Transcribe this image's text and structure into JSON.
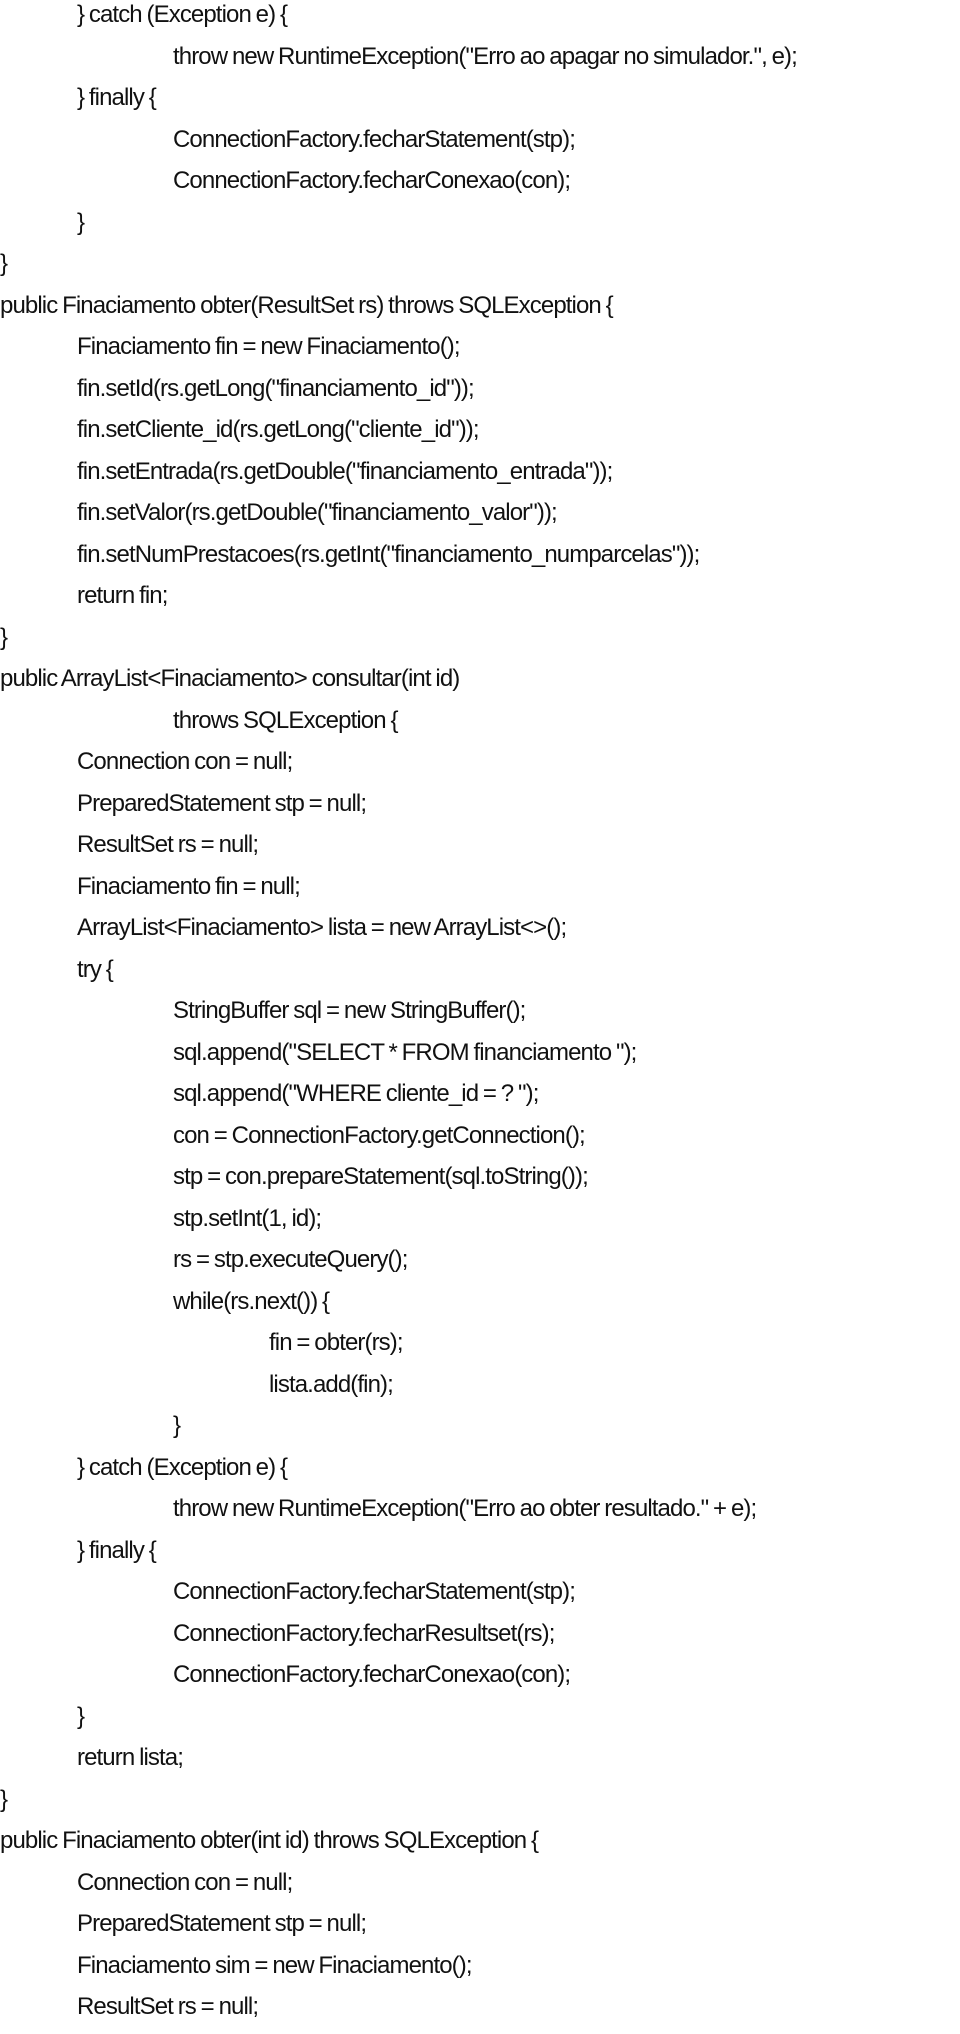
{
  "document": {
    "language": "Java",
    "lines": [
      {
        "indent": 1,
        "text": "} catch (Exception e) {"
      },
      {
        "indent": 2,
        "text": "throw new RuntimeException(\"Erro ao apagar no simulador.\", e);"
      },
      {
        "indent": 1,
        "text": "} finally {"
      },
      {
        "indent": 2,
        "text": "ConnectionFactory.fecharStatement(stp);"
      },
      {
        "indent": 2,
        "text": "ConnectionFactory.fecharConexao(con);"
      },
      {
        "indent": 1,
        "text": "}"
      },
      {
        "indent": 0,
        "text": "}"
      },
      {
        "indent": 0,
        "text": "public Finaciamento obter(ResultSet rs) throws SQLException {"
      },
      {
        "indent": 1,
        "text": "Finaciamento fin = new Finaciamento();"
      },
      {
        "indent": 1,
        "text": "fin.setId(rs.getLong(\"financiamento_id\"));"
      },
      {
        "indent": 1,
        "text": "fin.setCliente_id(rs.getLong(\"cliente_id\"));"
      },
      {
        "indent": 1,
        "text": "fin.setEntrada(rs.getDouble(\"financiamento_entrada\"));"
      },
      {
        "indent": 1,
        "text": "fin.setValor(rs.getDouble(\"financiamento_valor\"));"
      },
      {
        "indent": 1,
        "text": "fin.setNumPrestacoes(rs.getInt(\"financiamento_numparcelas\"));"
      },
      {
        "indent": 1,
        "text": "return fin;"
      },
      {
        "indent": 0,
        "text": "}"
      },
      {
        "indent": 0,
        "text": "public ArrayList<Finaciamento> consultar(int id)"
      },
      {
        "indent": 2,
        "text": "throws SQLException {"
      },
      {
        "indent": 1,
        "text": "Connection con = null;"
      },
      {
        "indent": 1,
        "text": "PreparedStatement stp = null;"
      },
      {
        "indent": 1,
        "text": "ResultSet rs = null;"
      },
      {
        "indent": 1,
        "text": "Finaciamento fin = null;"
      },
      {
        "indent": 1,
        "text": "ArrayList<Finaciamento> lista = new ArrayList<>();"
      },
      {
        "indent": 1,
        "text": "try {"
      },
      {
        "indent": 2,
        "text": "StringBuffer sql = new StringBuffer();"
      },
      {
        "indent": 2,
        "text": "sql.append(\"SELECT * FROM financiamento \");"
      },
      {
        "indent": 2,
        "text": "sql.append(\"WHERE cliente_id = ? \");"
      },
      {
        "indent": 2,
        "text": "con = ConnectionFactory.getConnection();"
      },
      {
        "indent": 2,
        "text": "stp = con.prepareStatement(sql.toString());"
      },
      {
        "indent": 2,
        "text": "stp.setInt(1, id);"
      },
      {
        "indent": 2,
        "text": "rs = stp.executeQuery();"
      },
      {
        "indent": 2,
        "text": "while(rs.next()) {"
      },
      {
        "indent": 3,
        "text": "fin = obter(rs);"
      },
      {
        "indent": 3,
        "text": "lista.add(fin);"
      },
      {
        "indent": 2,
        "text": "}"
      },
      {
        "indent": 1,
        "text": "} catch (Exception e) {"
      },
      {
        "indent": 2,
        "text": "throw new RuntimeException(\"Erro ao obter resultado.\" + e);"
      },
      {
        "indent": 1,
        "text": "} finally {"
      },
      {
        "indent": 2,
        "text": "ConnectionFactory.fecharStatement(stp);"
      },
      {
        "indent": 2,
        "text": "ConnectionFactory.fecharResultset(rs);"
      },
      {
        "indent": 2,
        "text": "ConnectionFactory.fecharConexao(con);"
      },
      {
        "indent": 1,
        "text": "}"
      },
      {
        "indent": 1,
        "text": "return lista;"
      },
      {
        "indent": 0,
        "text": "}"
      },
      {
        "indent": 0,
        "text": "public Finaciamento obter(int id) throws SQLException {"
      },
      {
        "indent": 1,
        "text": "Connection con = null;"
      },
      {
        "indent": 1,
        "text": "PreparedStatement stp = null;"
      },
      {
        "indent": 1,
        "text": "Finaciamento sim = new Finaciamento();"
      },
      {
        "indent": 1,
        "text": "ResultSet rs = null;"
      }
    ]
  }
}
